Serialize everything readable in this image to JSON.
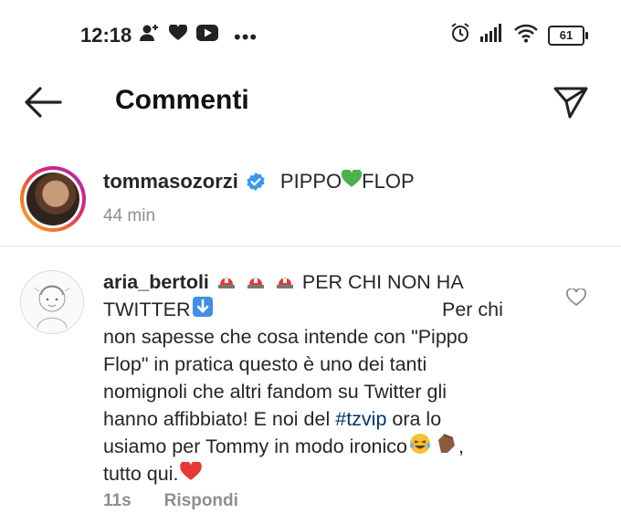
{
  "status_bar": {
    "time": "12:18",
    "battery": "61",
    "more_dots": "•••",
    "icons": [
      "person-add-icon",
      "heart-icon",
      "youtube-icon",
      "alarm-icon",
      "signal-icon",
      "wifi-icon",
      "battery-icon"
    ]
  },
  "header": {
    "title": "Commenti"
  },
  "caption": {
    "username": "tommasozorzi",
    "text_before": "PIPPO",
    "emoji": "💚",
    "text_after": "FLOP",
    "time": "44 min"
  },
  "comment": {
    "username": "aria_bertoli",
    "line1_text": " PER CHI NON HA",
    "line2_start": "TWITTER",
    "line2_end": "Per chi",
    "line3": "non sapesse che cosa intende con \"Pippo",
    "line4": "Flop\" in pratica questo è uno dei tanti",
    "line5": "nomignoli che altri fandom su Twitter gli",
    "line6_start": "hanno affibbiato! E noi del ",
    "hashtag": "#tzvip",
    "line6_end": " ora lo",
    "line7": "usiamo per Tommy in modo ironico",
    "line7_end": ",",
    "line8": "tutto qui.",
    "time": "11s",
    "reply_label": "Rispondi"
  },
  "colors": {
    "verified": "#3897f0",
    "hashtag": "#00376b",
    "meta": "#8e8e8e",
    "heart": "#e0245e"
  }
}
